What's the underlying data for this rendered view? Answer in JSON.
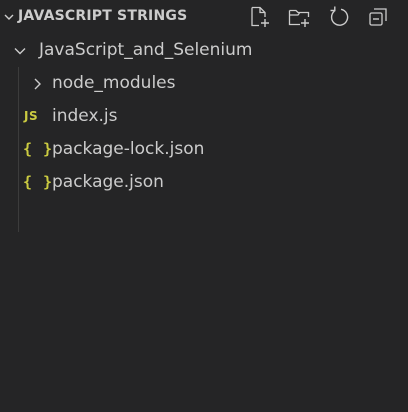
{
  "explorer": {
    "section_title": "JAVASCRIPT STRINGS",
    "actions": [
      {
        "name": "new-file-button",
        "icon": "new-file-icon"
      },
      {
        "name": "new-folder-button",
        "icon": "new-folder-icon"
      },
      {
        "name": "refresh-explorer-button",
        "icon": "refresh-icon"
      },
      {
        "name": "collapse-folders-button",
        "icon": "collapse-all-icon"
      }
    ],
    "root_folder": {
      "label": "JavaScript_and_Selenium",
      "expanded": true
    },
    "items": [
      {
        "label": "node_modules",
        "type": "folder",
        "expanded": false
      },
      {
        "label": "index.js",
        "type": "file",
        "icon_text": "JS"
      },
      {
        "label": "package-lock.json",
        "type": "file",
        "icon_text": "{ }"
      },
      {
        "label": "package.json",
        "type": "file",
        "icon_text": "{ }"
      }
    ]
  },
  "colors": {
    "background": "#252526",
    "text": "#cccccc",
    "file_icon": "#cbcb41",
    "indent_guide": "#3c3c3c"
  }
}
